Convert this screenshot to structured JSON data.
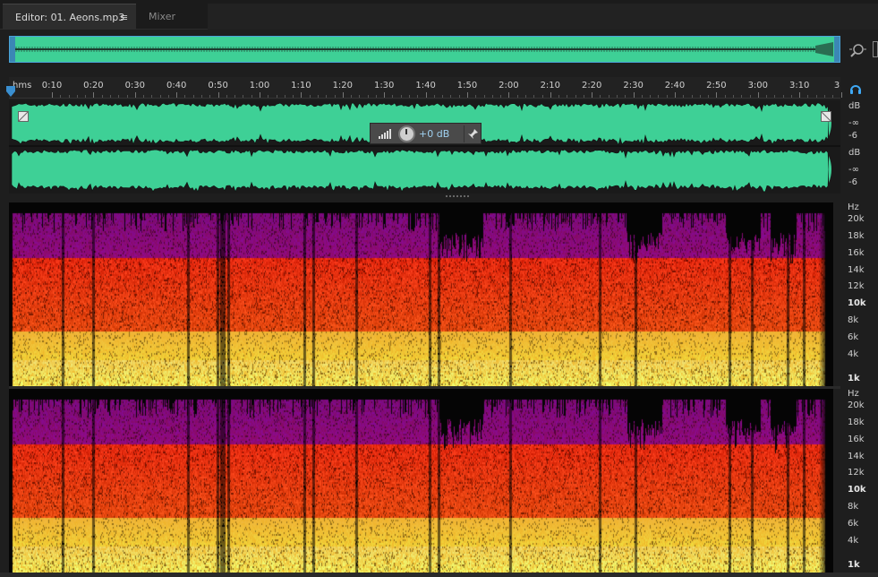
{
  "tabs": {
    "editor_label": "Editor: 01. Aeons.mp3",
    "editor_menu_icon": "≡",
    "mixer_label": "Mixer"
  },
  "ruler": {
    "unit": "hms",
    "ticks": [
      "0:10",
      "0:20",
      "0:30",
      "0:40",
      "0:50",
      "1:00",
      "1:10",
      "1:20",
      "1:30",
      "1:40",
      "1:50",
      "2:00",
      "2:10",
      "2:20",
      "2:30",
      "2:40",
      "2:50",
      "3:00",
      "3:10",
      "3"
    ]
  },
  "db_scale": {
    "unit": "dB",
    "marks": [
      "-∞",
      "-6"
    ]
  },
  "hud": {
    "value": "+0 dB"
  },
  "hz_scale": {
    "unit": "Hz",
    "labels": [
      "20k",
      "18k",
      "16k",
      "14k",
      "12k",
      "10k",
      "8k",
      "6k",
      "4k",
      "1k"
    ]
  },
  "icons": {
    "zoom": "zoom-icon",
    "headphones": "headphones-icon",
    "pin": "pin-icon",
    "playhead": "playhead-icon",
    "volume_bars": "volume-bars-icon",
    "knob": "knob-icon"
  },
  "colors": {
    "waveform": "#3ed096",
    "selection_border": "#4aa3d8",
    "hud_value": "#9fd0f0"
  }
}
